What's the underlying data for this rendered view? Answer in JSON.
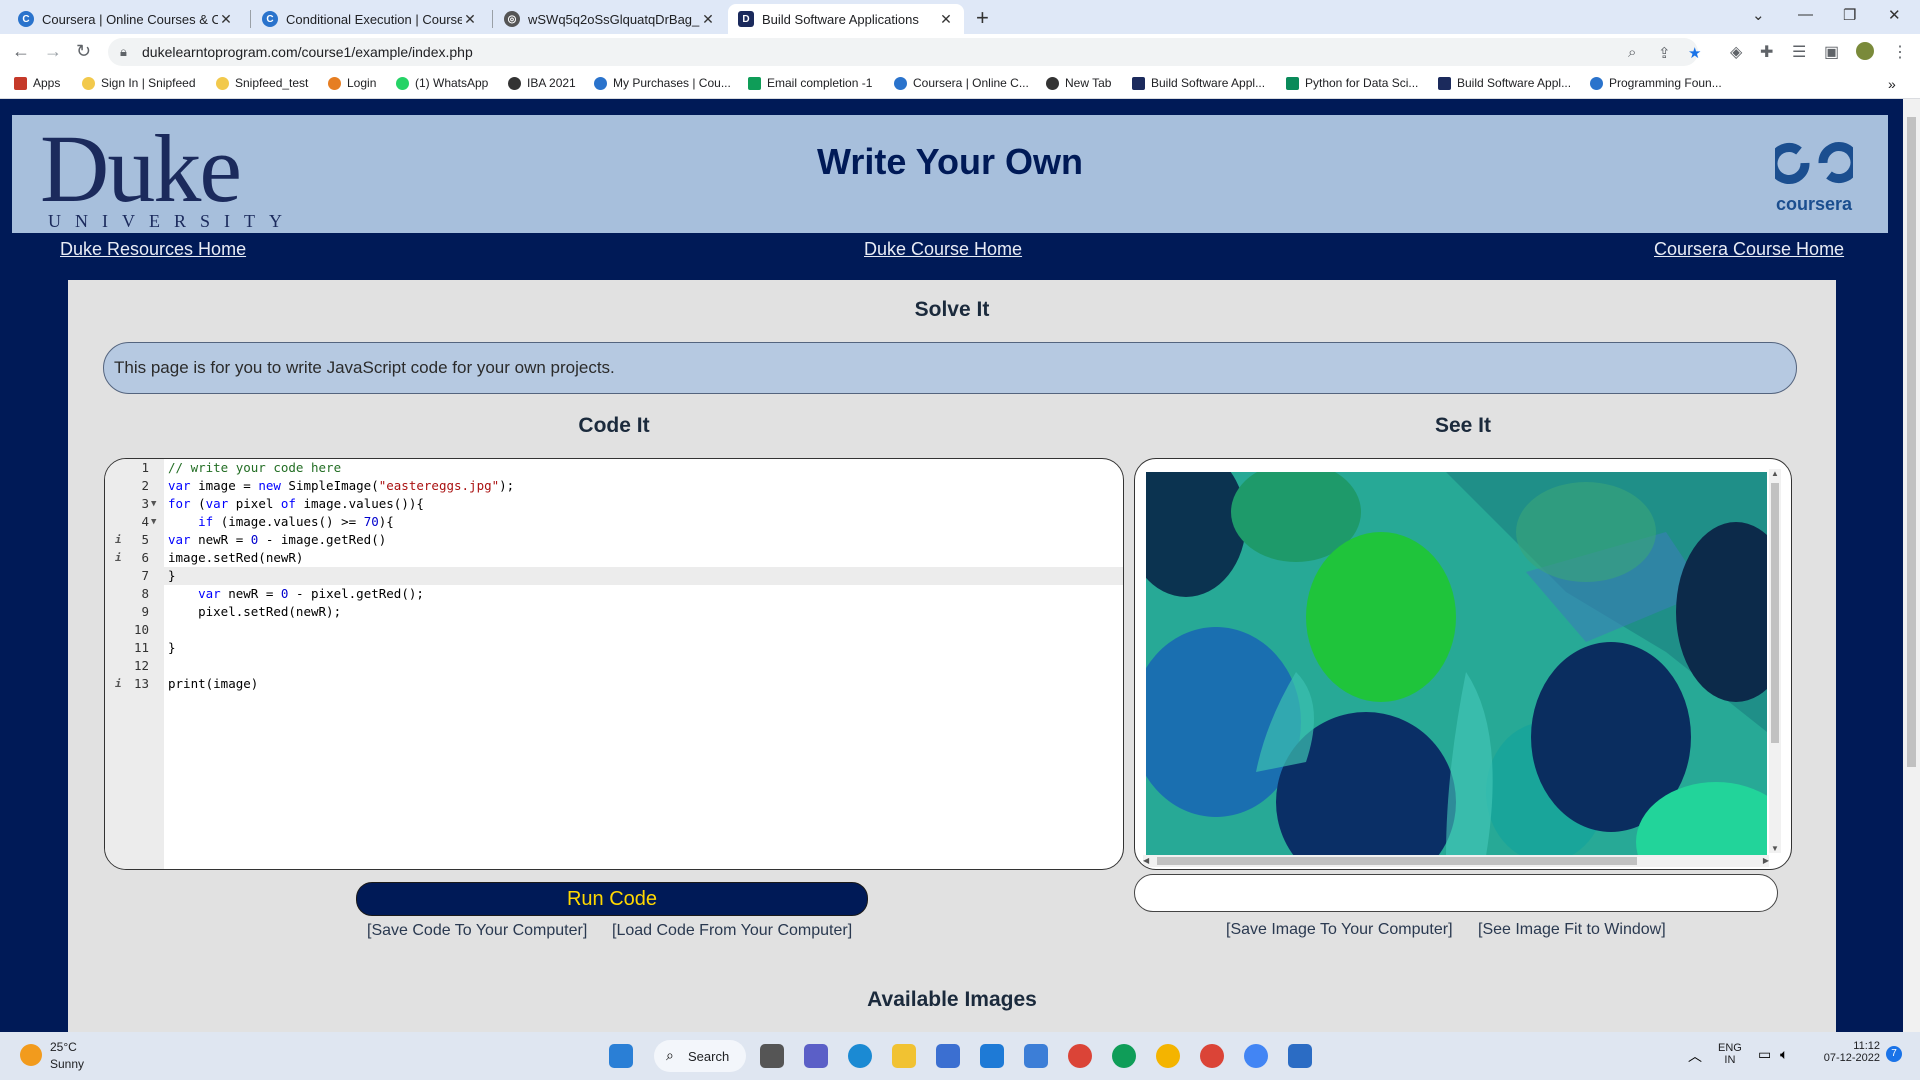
{
  "browser": {
    "tabs": [
      {
        "label": "Coursera | Online Courses & Cre",
        "active": false
      },
      {
        "label": "Conditional Execution | Coursera",
        "active": false
      },
      {
        "label": "wSWq5q2oSsGlquatqDrBag_bfdi",
        "active": false
      },
      {
        "label": "Build Software Applications",
        "active": true
      }
    ],
    "url": "dukelearntoprogram.com/course1/example/index.php",
    "bookmarks": [
      "Apps",
      "Sign In | Snipfeed",
      "Snipfeed_test",
      "Login",
      "(1) WhatsApp",
      "IBA 2021",
      "My Purchases | Cou...",
      "Email completion -1",
      "Coursera | Online C...",
      "New Tab",
      "Build Software Appl...",
      "Python for Data Sci...",
      "Build Software Appl...",
      "Programming Foun..."
    ]
  },
  "header": {
    "duke_big": "Duke",
    "duke_small": "UNIVERSITY",
    "title": "Write Your Own",
    "coursera": "coursera"
  },
  "nav": {
    "left": "Duke Resources Home",
    "center": "Duke Course Home",
    "right": "Coursera Course Home"
  },
  "main": {
    "solve_heading": "Solve It",
    "info_text": "This page is for you to write JavaScript code for your own projects.",
    "code_heading": "Code It",
    "see_heading": "See It",
    "run_label": "Run Code",
    "save_code": "[Save Code To Your Computer]",
    "load_code": "[Load Code From Your Computer]",
    "save_image": "[Save Image To Your Computer]",
    "fit_image": "[See Image Fit to Window]",
    "available_heading": "Available Images",
    "code_lines": [
      "// write your code here",
      "var image = new SimpleImage(\"eastereggs.jpg\");",
      "for (var pixel of image.values()){",
      "    if (image.values() >= 70){",
      "var newR = 0 - image.getRed()",
      "image.setRed(newR)",
      "}",
      "    var newR = 0 - pixel.getRed();",
      "    pixel.setRed(newR);",
      "",
      "}",
      "",
      "print(image)"
    ]
  },
  "taskbar": {
    "temp": "25°C",
    "weather": "Sunny",
    "search": "Search",
    "lang1": "ENG",
    "lang2": "IN",
    "time": "11:12",
    "date": "07-12-2022",
    "badge": "7"
  }
}
